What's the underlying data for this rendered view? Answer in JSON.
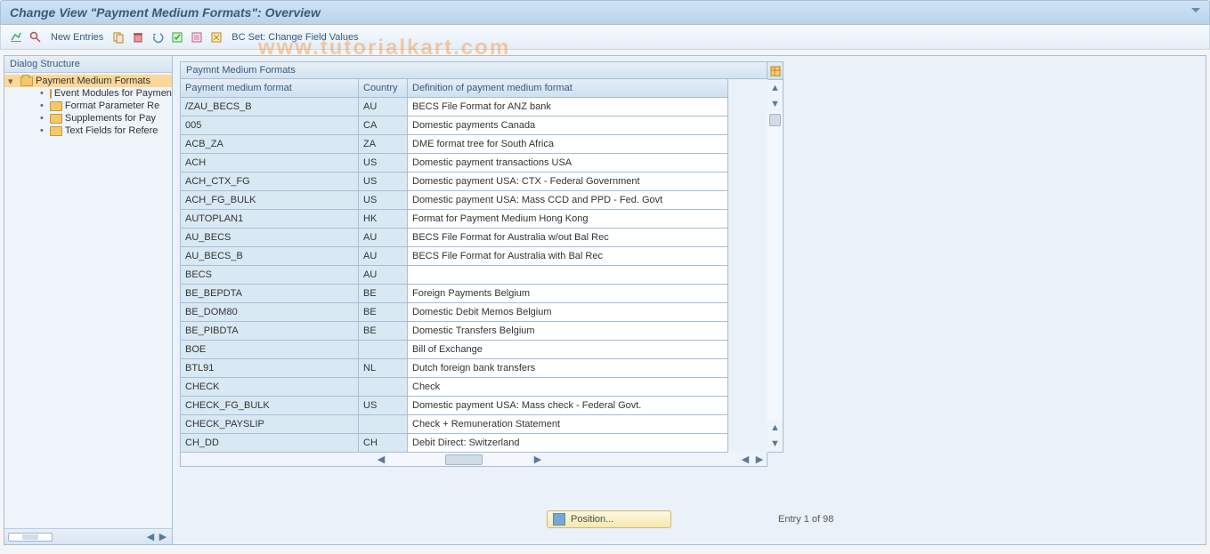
{
  "title": "Change View \"Payment Medium Formats\": Overview",
  "toolbar": {
    "new_entries": "New Entries",
    "bcset": "BC Set: Change Field Values"
  },
  "watermark": "www.tutorialkart.com",
  "tree": {
    "header": "Dialog Structure",
    "root": "Payment Medium Formats",
    "children": [
      "Event Modules for Payment",
      "Format Parameter Re",
      "Supplements for Pay",
      "Text Fields for Refere"
    ]
  },
  "grid": {
    "panel_title": "Paymnt Medium Formats",
    "columns": [
      "Payment medium format",
      "Country",
      "Definition of payment medium format"
    ],
    "rows": [
      {
        "fmt": "/ZAU_BECS_B",
        "cty": "AU",
        "def": "BECS File Format for ANZ bank"
      },
      {
        "fmt": "005",
        "cty": "CA",
        "def": "Domestic payments Canada"
      },
      {
        "fmt": "ACB_ZA",
        "cty": "ZA",
        "def": "DME format tree for South Africa"
      },
      {
        "fmt": "ACH",
        "cty": "US",
        "def": "Domestic payment transactions USA"
      },
      {
        "fmt": "ACH_CTX_FG",
        "cty": "US",
        "def": "Domestic payment USA: CTX - Federal Government"
      },
      {
        "fmt": "ACH_FG_BULK",
        "cty": "US",
        "def": "Domestic payment USA: Mass CCD and PPD - Fed. Govt"
      },
      {
        "fmt": "AUTOPLAN1",
        "cty": "HK",
        "def": "Format for Payment Medium Hong Kong"
      },
      {
        "fmt": "AU_BECS",
        "cty": "AU",
        "def": "BECS File Format for Australia w/out Bal Rec"
      },
      {
        "fmt": "AU_BECS_B",
        "cty": "AU",
        "def": "BECS File Format for Australia with Bal Rec"
      },
      {
        "fmt": "BECS",
        "cty": "AU",
        "def": ""
      },
      {
        "fmt": "BE_BEPDTA",
        "cty": "BE",
        "def": "Foreign Payments Belgium"
      },
      {
        "fmt": "BE_DOM80",
        "cty": "BE",
        "def": "Domestic Debit Memos Belgium"
      },
      {
        "fmt": "BE_PIBDTA",
        "cty": "BE",
        "def": "Domestic Transfers Belgium"
      },
      {
        "fmt": "BOE",
        "cty": "",
        "def": "Bill of Exchange"
      },
      {
        "fmt": "BTL91",
        "cty": "NL",
        "def": "Dutch foreign bank transfers"
      },
      {
        "fmt": "CHECK",
        "cty": "",
        "def": "Check"
      },
      {
        "fmt": "CHECK_FG_BULK",
        "cty": "US",
        "def": "Domestic payment USA: Mass check - Federal Govt."
      },
      {
        "fmt": "CHECK_PAYSLIP",
        "cty": "",
        "def": "Check + Remuneration Statement"
      },
      {
        "fmt": "CH_DD",
        "cty": "CH",
        "def": "Debit Direct: Switzerland"
      }
    ]
  },
  "footer": {
    "position_btn": "Position...",
    "entry_text": "Entry 1 of 98"
  }
}
